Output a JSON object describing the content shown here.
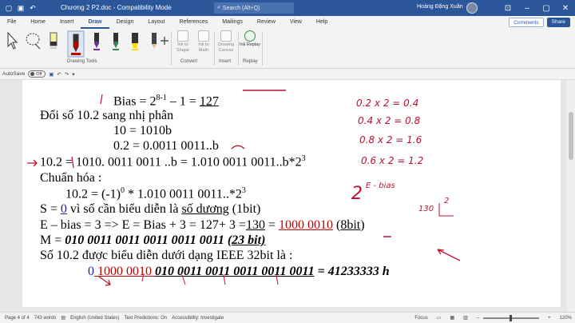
{
  "titlebar": {
    "doc_title": "Chương 2 P2.doc  -  Compatibility Mode",
    "search_placeholder": "Search (Alt+Q)",
    "user_name": "Hoàng Đặng Xuân",
    "bg": "#2b579a"
  },
  "tabs": [
    "File",
    "Home",
    "Insert",
    "Draw",
    "Design",
    "Layout",
    "References",
    "Mailings",
    "Review",
    "View",
    "Help"
  ],
  "active_tab": "Draw",
  "comments_label": "Comments",
  "share_label": "Share",
  "ribbon": {
    "drawing_tools_label": "Drawing Tools",
    "convert_label": "Convert",
    "insert_label": "Insert",
    "replay_label": "Replay",
    "ink_to_shape": "Ink to Shape",
    "ink_to_math": "Ink to Math",
    "drawing_canvas": "Drawing Canvas",
    "ink_replay": "Ink Replay"
  },
  "quickaccess": {
    "autosave": "AutoSave",
    "toggle": "Off"
  },
  "doc": {
    "l1a": "Bias = 2",
    "l1sup": "8-1",
    "l1b": " – 1 = ",
    "l1c": "127",
    "l2": "Đổi số 10.2 sang nhị phân",
    "l3": "10 = 1010b",
    "l4": "0.2 = 0.0011 0011..b",
    "l5a": "10.2 =  1010. 0011 0011 ..b = 1.010 0011 0011..b*2",
    "l5sup": "3",
    "l6": "Chuẩn hóa :",
    "l7a": "10.2 = (-1)",
    "l7sup0": "0",
    "l7b": " * 1.010 0011 0011..*2",
    "l7sup3": "3",
    "l8a": "S = ",
    "l8b": "0",
    "l8c": " vì số cần biểu diễn là ",
    "l8d": "số dương",
    "l8e": " (1bit)",
    "l9a": "E – bias = 3 => E = Bias + 3 = 127+ 3 =",
    "l9b": "130",
    "l9c": " = ",
    "l9d": "1000 0010",
    "l9e": " (",
    "l9f": "8bit",
    "l9g": ")",
    "l10a": "M = ",
    "l10b": "010 0011 0011 0011 0011 0011 ",
    "l10c": "(23 bit)",
    "l11": "Số 10.2 được biểu diễn dưới dạng IEEE 32bit là :",
    "l12a": "0",
    "l12b": " 1000 0010 ",
    "l12c": "010 0011 0011 0011 0011 0011",
    "l12d": " = 41233333 h"
  },
  "handwriting": {
    "h1": "0.2 x 2 = 0.4",
    "h2": "0.4 x 2 = 0.8",
    "h3": "0.8 x 2 = 1.6",
    "h4": "0.6 x 2 = 1.2",
    "h5a": "2",
    "h5b": "E - bias",
    "h6a": "130",
    "h6b": "2"
  },
  "status": {
    "page": "Page 4 of 4",
    "words": "743 words",
    "language": "English (United States)",
    "predictions": "Text Predictions: On",
    "accessibility": "Accessibility: Investigate",
    "focus": "Focus",
    "zoom": "120%"
  }
}
